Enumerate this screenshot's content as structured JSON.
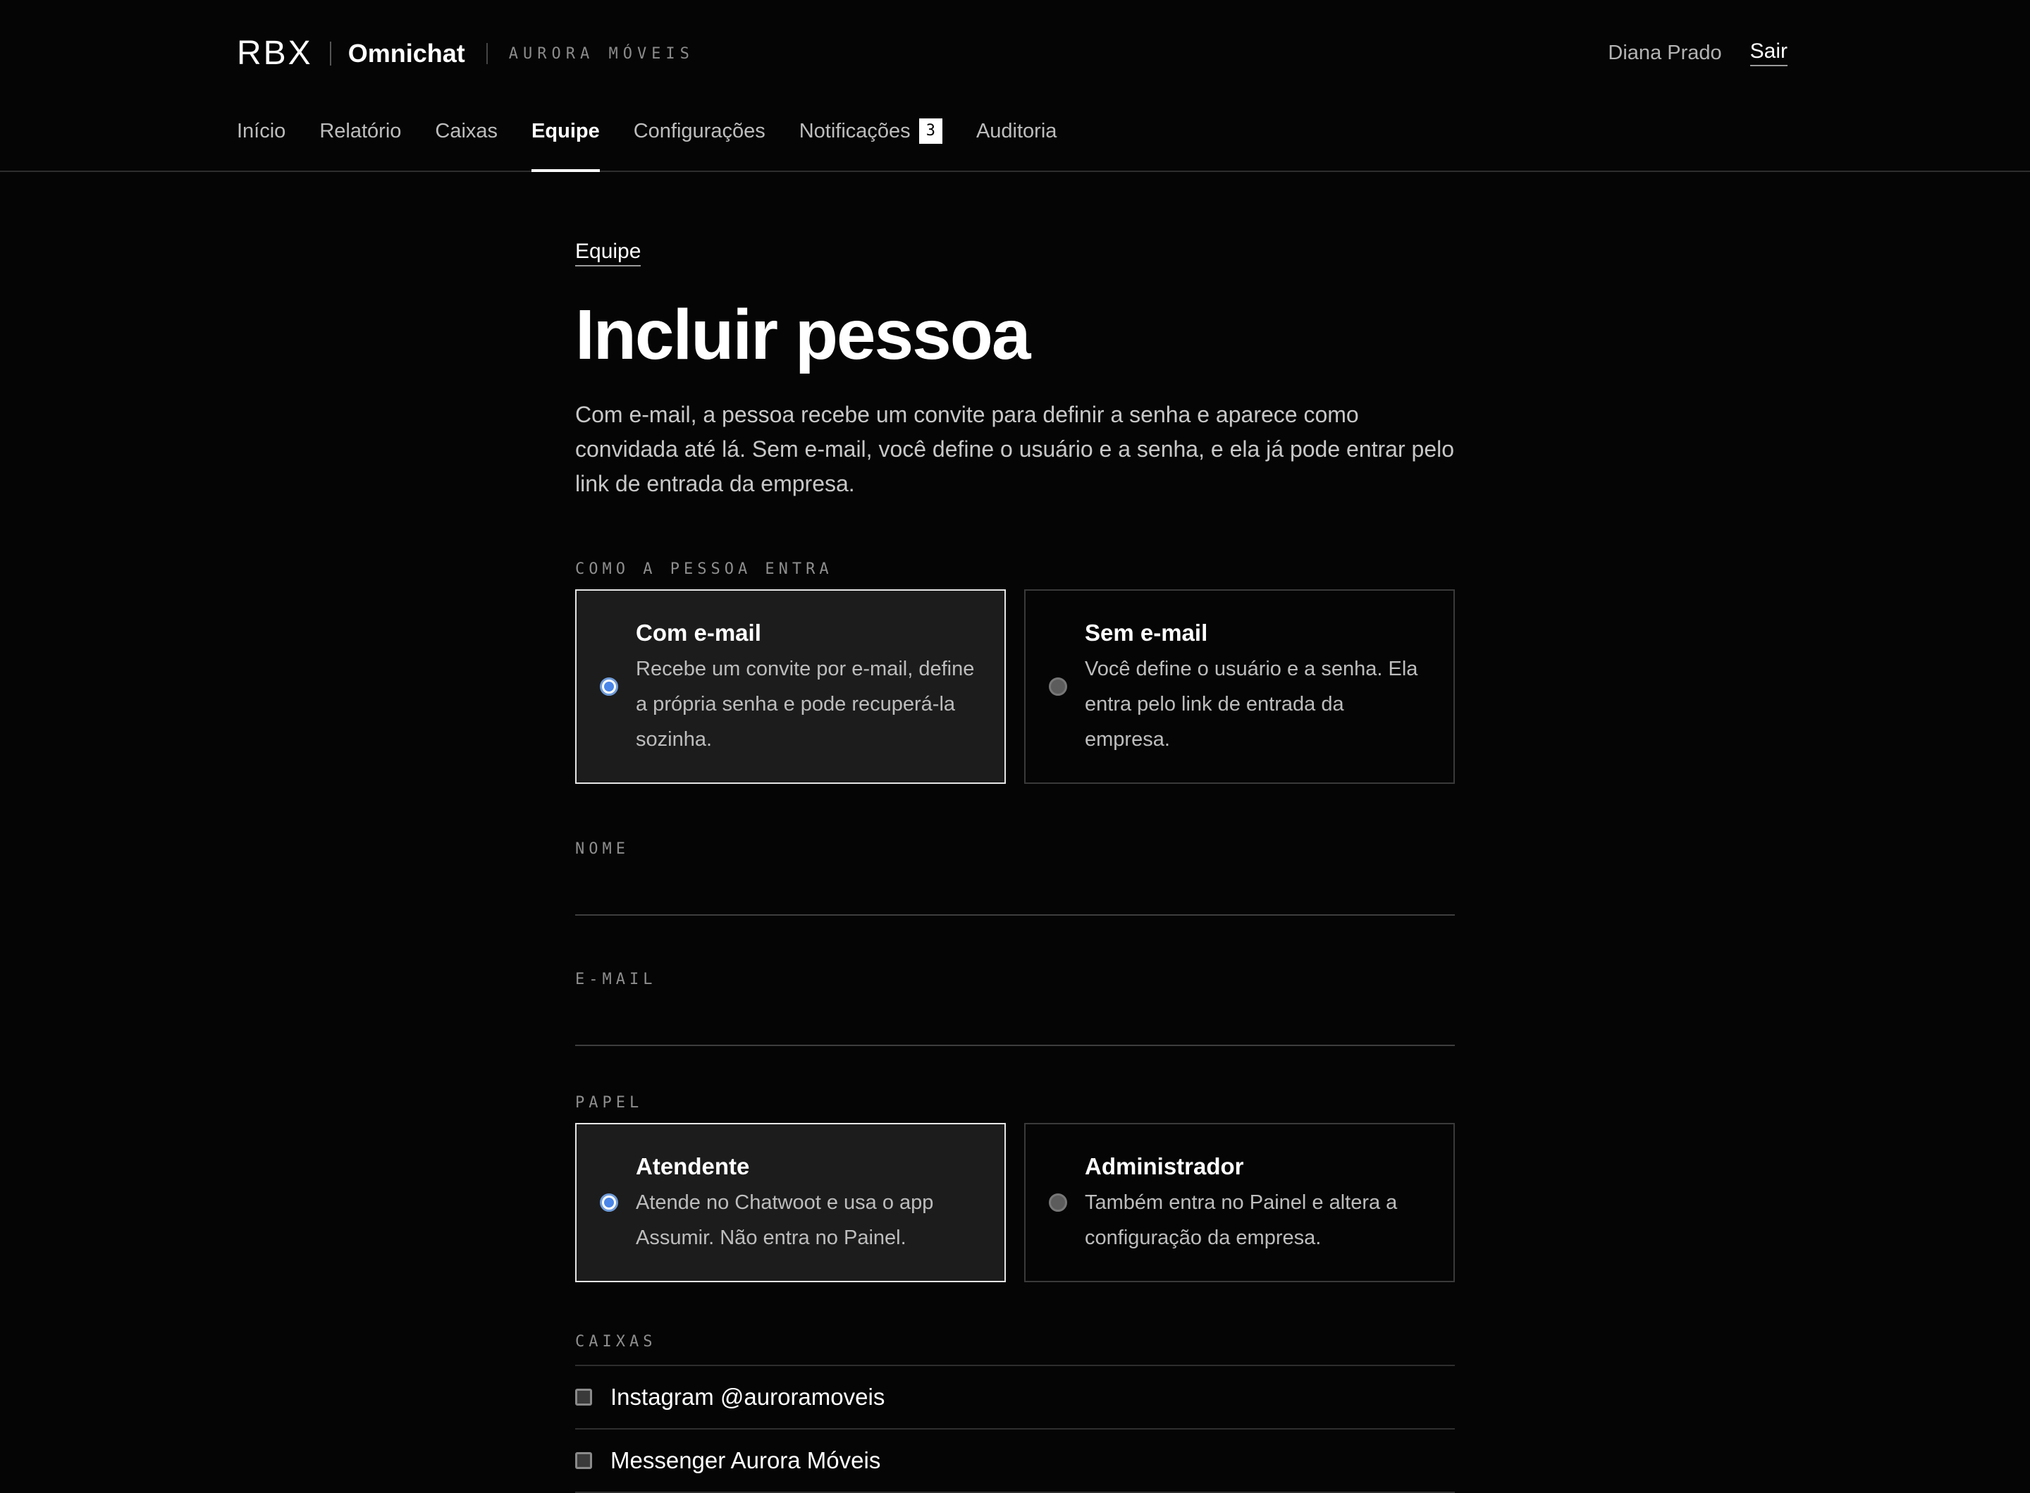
{
  "header": {
    "logo": "RBX",
    "product": "Omnichat",
    "company": "AURORA MÓVEIS",
    "user_name": "Diana Prado",
    "logout_label": "Sair"
  },
  "nav": {
    "items": [
      {
        "label": "Início"
      },
      {
        "label": "Relatório"
      },
      {
        "label": "Caixas"
      },
      {
        "label": "Equipe",
        "active": true
      },
      {
        "label": "Configurações"
      },
      {
        "label": "Notificações",
        "badge": "3"
      },
      {
        "label": "Auditoria"
      }
    ]
  },
  "page": {
    "breadcrumb": "Equipe",
    "title": "Incluir pessoa",
    "intro": "Com e-mail, a pessoa recebe um convite para definir a senha e aparece como convidada até lá. Sem e-mail, você define o usuário e a senha, e ela já pode entrar pelo link de entrada da empresa."
  },
  "access": {
    "label": "COMO A PESSOA ENTRA",
    "options": [
      {
        "title": "Com e-mail",
        "description": "Recebe um convite por e-mail, define a própria senha e pode recuperá-la sozinha.",
        "selected": true
      },
      {
        "title": "Sem e-mail",
        "description": "Você define o usuário e a senha. Ela entra pelo link de entrada da empresa.",
        "selected": false
      }
    ]
  },
  "form": {
    "name_label": "NOME",
    "name_value": "",
    "email_label": "E-MAIL",
    "email_value": ""
  },
  "role": {
    "label": "PAPEL",
    "options": [
      {
        "title": "Atendente",
        "description": "Atende no Chatwoot e usa o app Assumir. Não entra no Painel.",
        "selected": true
      },
      {
        "title": "Administrador",
        "description": "Também entra no Painel e altera a configuração da empresa.",
        "selected": false
      }
    ]
  },
  "inboxes": {
    "label": "CAIXAS",
    "items": [
      {
        "label": "Instagram @auroramoveis",
        "checked": false
      },
      {
        "label": "Messenger Aurora Móveis",
        "checked": false
      }
    ]
  },
  "colors": {
    "background": "#050505",
    "selected_card": "#1c1c1c",
    "accent_radio": "#4a86e8",
    "text_primary": "#ffffff",
    "text_muted": "#bdbdbd"
  }
}
